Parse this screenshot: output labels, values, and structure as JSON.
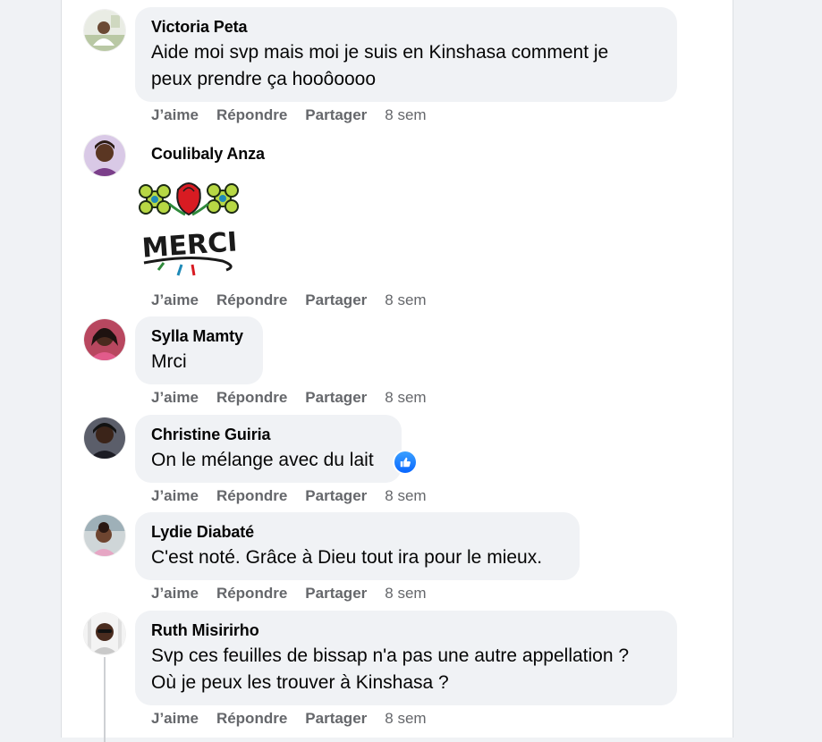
{
  "actions": {
    "like": "J’aime",
    "reply": "Répondre",
    "share": "Partager"
  },
  "comments": [
    {
      "author": "Victoria Peta",
      "lines": [
        "Aide moi svp mais moi je suis en Kinshasa comment je",
        "peux prendre ça hooôoooo"
      ],
      "time": "8 sem"
    },
    {
      "author": "Coulibaly Anza",
      "sticker_text": "MERCI",
      "time": "8 sem"
    },
    {
      "author": "Sylla Mamty",
      "lines": [
        "Mrci"
      ],
      "time": "8 sem"
    },
    {
      "author": "Christine Guiria",
      "lines": [
        "On le mélange avec du lait"
      ],
      "time": "8 sem",
      "reaction": "like-icon"
    },
    {
      "author": "Lydie Diabaté",
      "lines": [
        "C'est noté. Grâce à Dieu tout ira pour le mieux."
      ],
      "time": "8 sem"
    },
    {
      "author": "Ruth Misirirho",
      "lines": [
        "Svp ces feuilles de bissap n'a pas une autre appellation ?",
        "Où je peux les trouver à Kinshasa ?"
      ],
      "time": "8 sem"
    }
  ],
  "colors": {
    "bubble": "#f0f2f5",
    "meta": "#65676b",
    "text": "#050505",
    "like": "#0866ff"
  }
}
